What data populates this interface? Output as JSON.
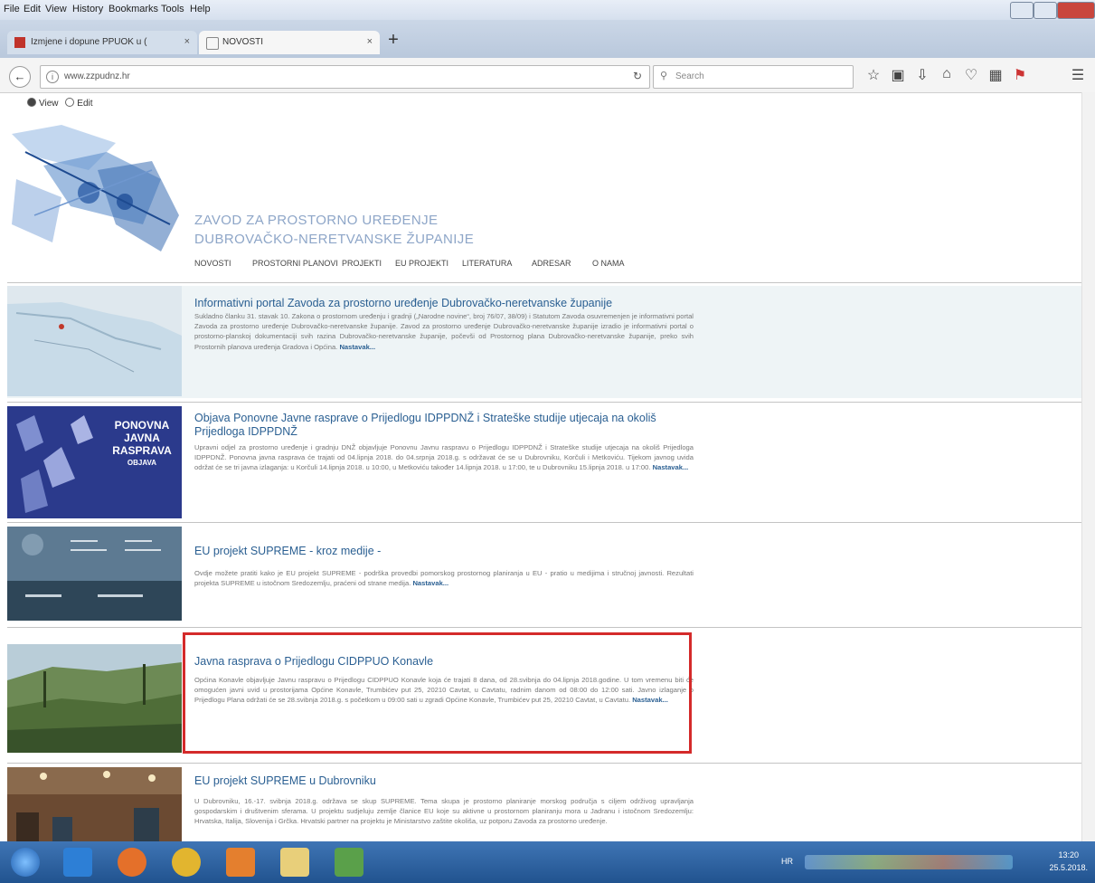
{
  "menubar": {
    "items": [
      "File",
      "Edit",
      "View",
      "History",
      "Bookmarks",
      "Tools",
      "Help"
    ]
  },
  "tabs": [
    {
      "label": "Izmjene i dopune PPUOK u (",
      "close": "×"
    },
    {
      "label": "NOVOSTI",
      "close": "×"
    }
  ],
  "new_tab_label": "+",
  "navbar": {
    "url": "www.zzpudnz.hr",
    "search_placeholder": "Search"
  },
  "view_edit": {
    "view": "View",
    "edit": "Edit"
  },
  "site": {
    "title_line1": "ZAVOD ZA PROSTORNO UREĐENJE",
    "title_line2": "DUBROVAČKO-NERETVANSKE ŽUPANIJE"
  },
  "nav": [
    "NOVOSTI",
    "PROSTORNI PLANOVI",
    "PROJEKTI",
    "EU PROJEKTI",
    "LITERATURA",
    "ADRESAR",
    "O NAMA"
  ],
  "news": [
    {
      "title": "Informativni portal Zavoda za prostorno uređenje Dubrovačko-neretvanske županije",
      "body": "Sukladno članku 31. stavak 10. Zakona o prostornom uređenju i gradnji („Narodne novine“, broj 76/07, 38/09) i Statutom Zavoda osuvremenjen je informativni portal Zavoda za prostorno uređenje Dubrovačko-neretvanske županije. Zavod za prostorno uređenje Dubrovačko-neretvanske županije izradio je informativni portal o prostorno-planskoj dokumentaciji svih razina Dubrovačko-neretvanske županije, počevši od Prostornog plana Dubrovačko-neretvanske županije, preko svih Prostornih planova uređenja Gradova i Općina.",
      "more": "Nastavak..."
    },
    {
      "title": "Objava Ponovne Javne rasprave o Prijedlogu IDPPDNŽ i Strateške studije utjecaja na okoliš Prijedloga IDPPDNŽ",
      "body": "Upravni odjel za prostorno uređenje i gradnju DNŽ objavljuje Ponovnu Javnu raspravu o Prijedlogu IDPPDNŽ i Strateške studije utjecaja na okoliš Prijedloga IDPPDNŽ. Ponovna javna rasprava će trajati od 04.lipnja 2018. do 04.srpnja 2018.g. s održavat će se u Dubrovniku, Korčuli i Metkoviću. Tijekom javnog uvida održat će se tri javna izlaganja: u Korčuli 14.lipnja 2018. u 10:00, u Metkoviću također 14.lipnja 2018. u 17:00, te u Dubrovniku 15.lipnja 2018. u 17:00.",
      "more": "Nastavak...",
      "banner": [
        "PONOVNA",
        "JAVNA",
        "RASPRAVA",
        "OBJAVA"
      ]
    },
    {
      "title": "EU projekt SUPREME - kroz medije -",
      "body": "Ovdje možete pratiti kako je EU projekt SUPREME - podrška provedbi pomorskog prostornog planiranja u EU - pratio u medijima i stručnoj javnosti. Rezultati projekta SUPREME u istočnom Sredozemlju, praćeni od strane medija.",
      "more": "Nastavak..."
    },
    {
      "title": "Javna rasprava o Prijedlogu CIDPPUO Konavle",
      "body": "Općina Konavle objavljuje Javnu raspravu o Prijedlogu CIDPPUO Konavle koja će trajati 8 dana, od 28.svibnja do 04.lipnja 2018.godine. U tom vremenu biti će omogućen javni uvid u prostorijama Općine Konavle, Trumbićev put 25, 20210 Cavtat, u Cavtatu, radnim danom od 08:00 do 12:00 sati. Javno izlaganje o Prijedlogu Plana održati će se 28.svibnja 2018.g. s početkom u 09:00 sati u zgradi Općine Konavle, Trumbićev put 25, 20210 Cavtat, u Cavtatu.",
      "more": "Nastavak..."
    },
    {
      "title": "EU projekt SUPREME u Dubrovniku",
      "body": "U Dubrovniku, 16.-17. svibnja 2018.g. održava se skup SUPREME. Tema skupa je prostorno planiranje morskog područja s ciljem održivog upravljanja gospodarskim i društvenim sferama. U projektu sudjeluju zemlje članice EU koje su aktivne u prostornom planiranju mora u Jadranu i istočnom Sredozemlju: Hrvatska, Italija, Slovenija i Grčka. Hrvatski partner na projektu je Ministarstvo zaštite okoliša, uz potporu Zavoda za prostorno uređenje.",
      "more": ""
    }
  ],
  "taskbar": {
    "lang": "HR",
    "time": "13:20",
    "date": "25.5.2018."
  }
}
